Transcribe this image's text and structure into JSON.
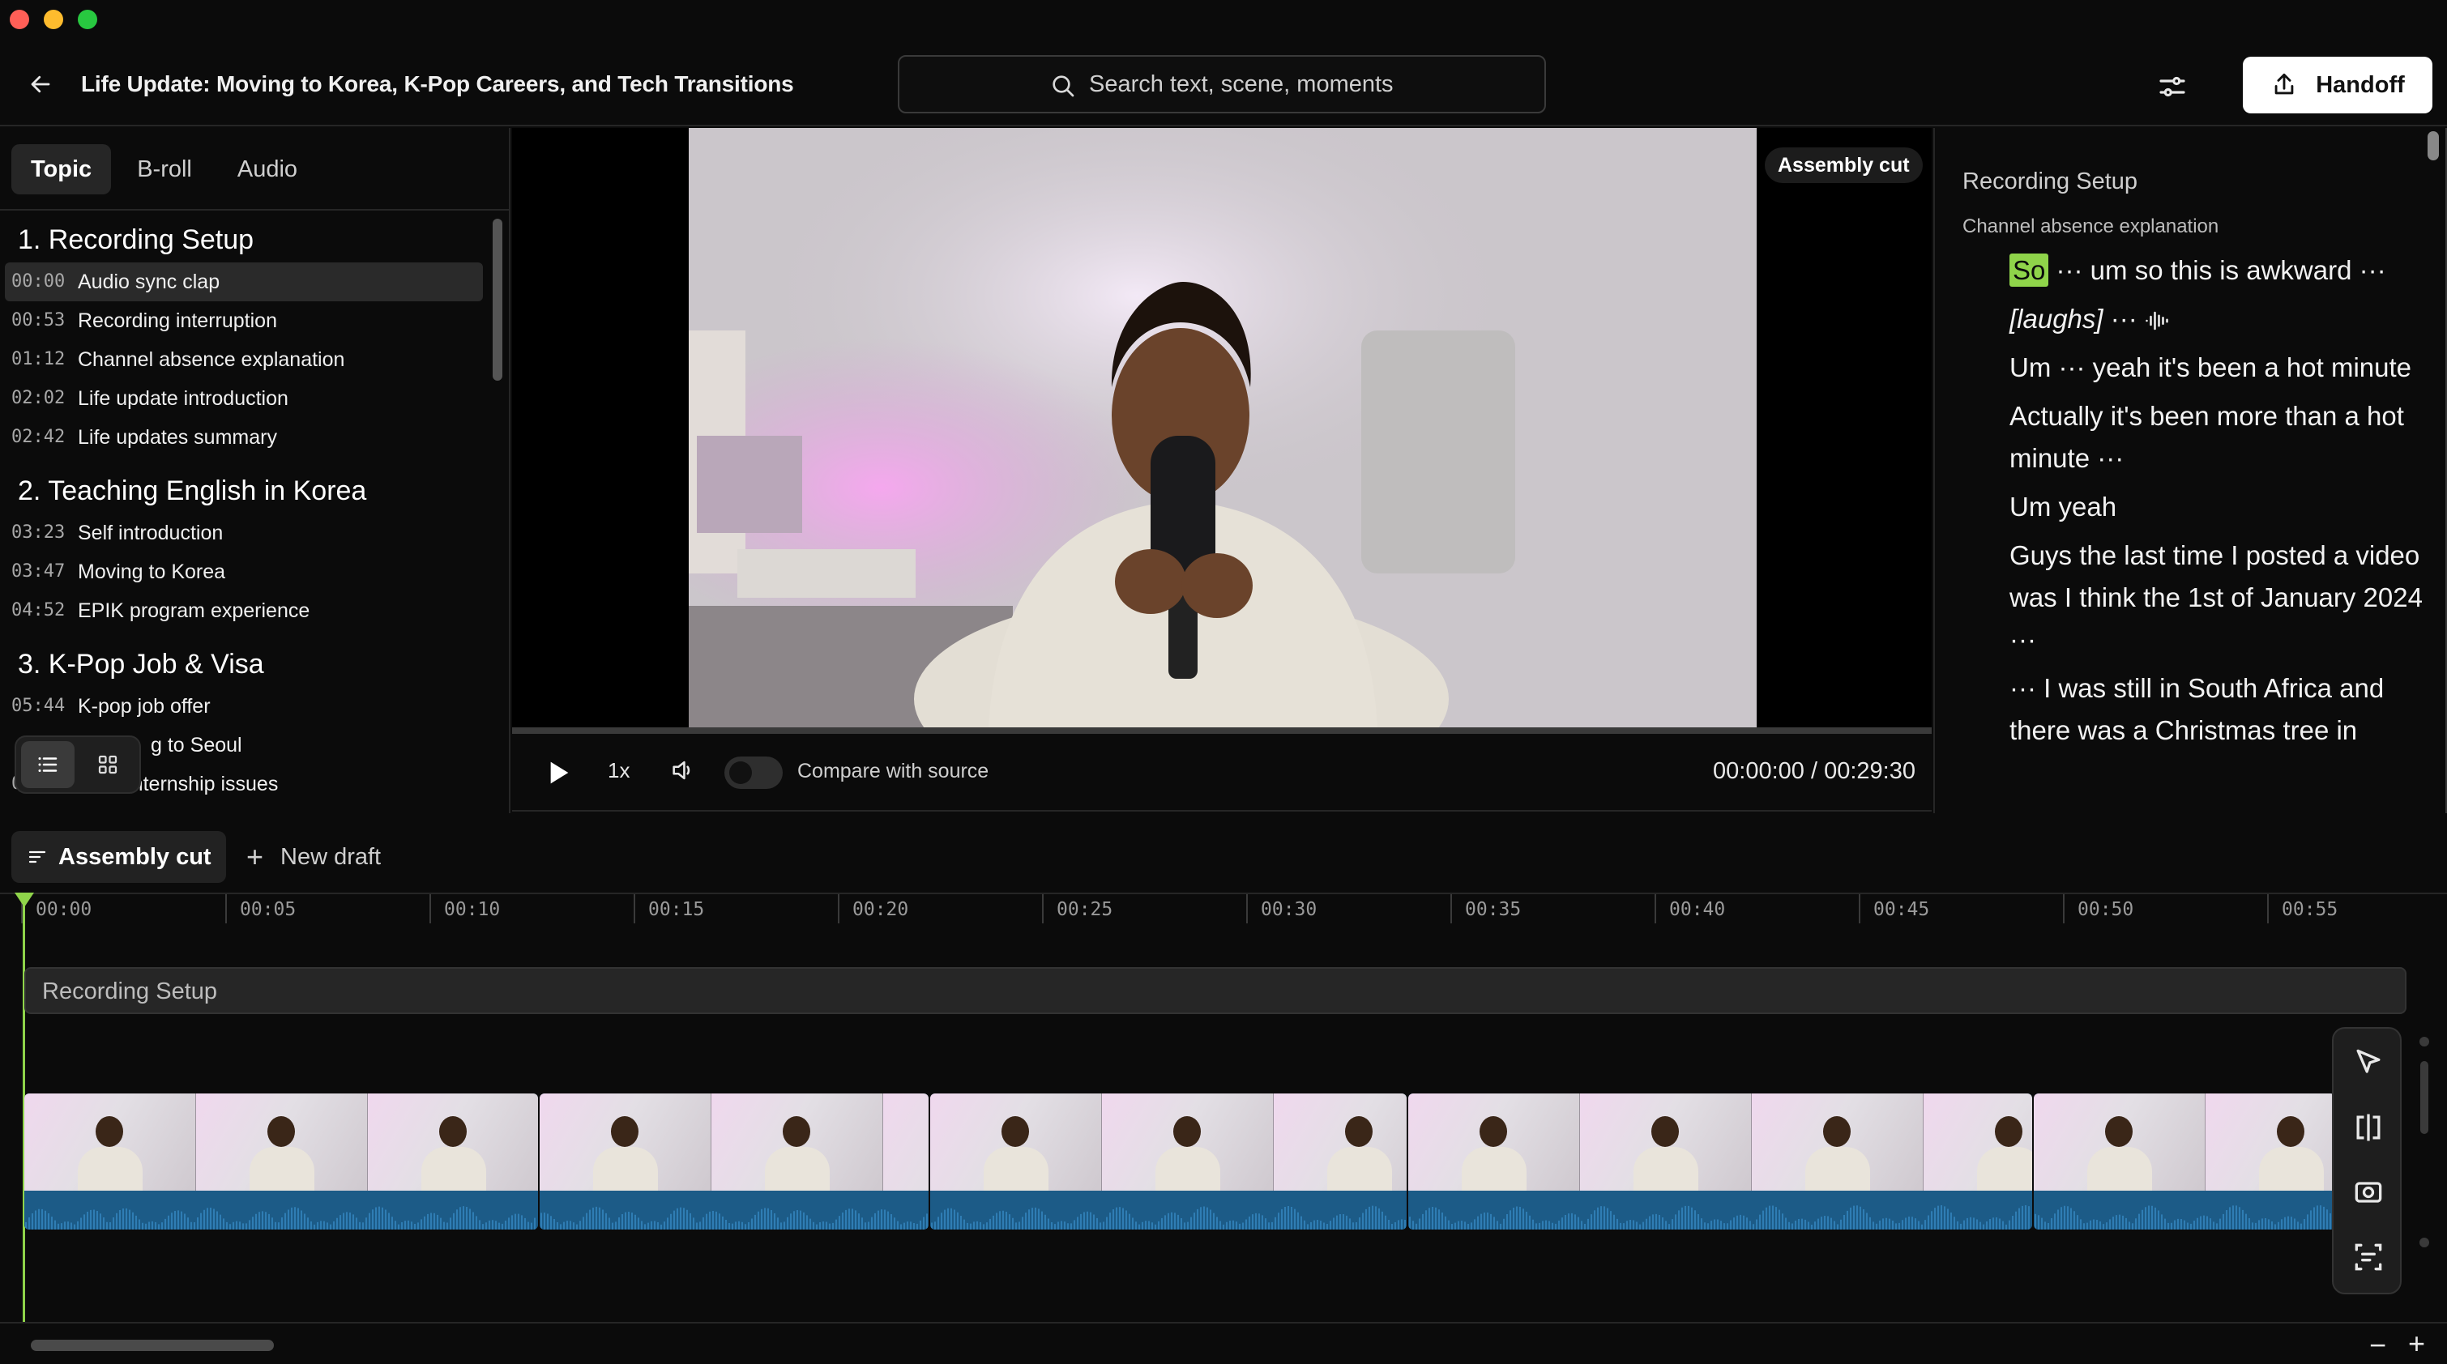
{
  "window": {
    "traffic_lights": {
      "close": "#ff5f57",
      "minimize": "#febc2e",
      "maximize": "#28c840"
    }
  },
  "header": {
    "title": "Life Update: Moving to Korea, K-Pop Careers, and Tech Transitions",
    "search_placeholder": "Search text, scene, moments",
    "handoff_label": "Handoff"
  },
  "left_panel": {
    "tabs": [
      "Topic",
      "B-roll",
      "Audio"
    ],
    "active_tab": "Topic",
    "sections": [
      {
        "title": "1. Recording Setup",
        "items": [
          {
            "time": "00:00",
            "label": "Audio sync clap",
            "active": true
          },
          {
            "time": "00:53",
            "label": "Recording interruption"
          },
          {
            "time": "01:12",
            "label": "Channel absence explanation"
          },
          {
            "time": "02:02",
            "label": "Life update introduction"
          },
          {
            "time": "02:42",
            "label": "Life updates summary"
          }
        ]
      },
      {
        "title": "2. Teaching English in Korea",
        "items": [
          {
            "time": "03:23",
            "label": "Self introduction"
          },
          {
            "time": "03:47",
            "label": "Moving to Korea"
          },
          {
            "time": "04:52",
            "label": "EPIK program experience"
          }
        ]
      },
      {
        "title": "3. K-Pop Job & Visa",
        "items": [
          {
            "time": "05:44",
            "label": "K-pop job offer"
          },
          {
            "time": "",
            "label": "g to Seoul"
          },
          {
            "time": "09:21",
            "label": "D-10 internship issues"
          }
        ]
      }
    ]
  },
  "video": {
    "badge": "Assembly cut",
    "speed": "1x",
    "compare_label": "Compare with source",
    "time": "00:00:00 / 00:29:30",
    "progress": 0.0
  },
  "transcript": {
    "title": "Recording Setup",
    "subtitle": "Channel absence explanation",
    "highlight_word": "So",
    "lines": [
      {
        "rest": " ··· um so this is awkward ···"
      },
      {
        "italic": "[laughs]",
        "rest": " ··· "
      },
      {
        "rest": "Um ··· yeah it's been a hot minute"
      },
      {
        "rest": "Actually it's been more than a hot minute ···"
      },
      {
        "rest": "Um yeah"
      },
      {
        "rest": "Guys the last time I posted a video was I think the 1st of January 2024 ···"
      },
      {
        "rest": "··· I was still in South Africa and there was a Christmas tree in"
      }
    ]
  },
  "timeline": {
    "active_draft": "Assembly cut",
    "new_draft": "New draft",
    "ruler": [
      "00:00",
      "00:05",
      "00:10",
      "00:15",
      "00:20",
      "00:25",
      "00:30",
      "00:35",
      "00:40",
      "00:45",
      "00:50",
      "00:55"
    ],
    "section_label": "Recording Setup",
    "accent": "#8fd44a",
    "waveform_color": "#1c5b87",
    "zoom_out": "−",
    "zoom_in": "+"
  }
}
